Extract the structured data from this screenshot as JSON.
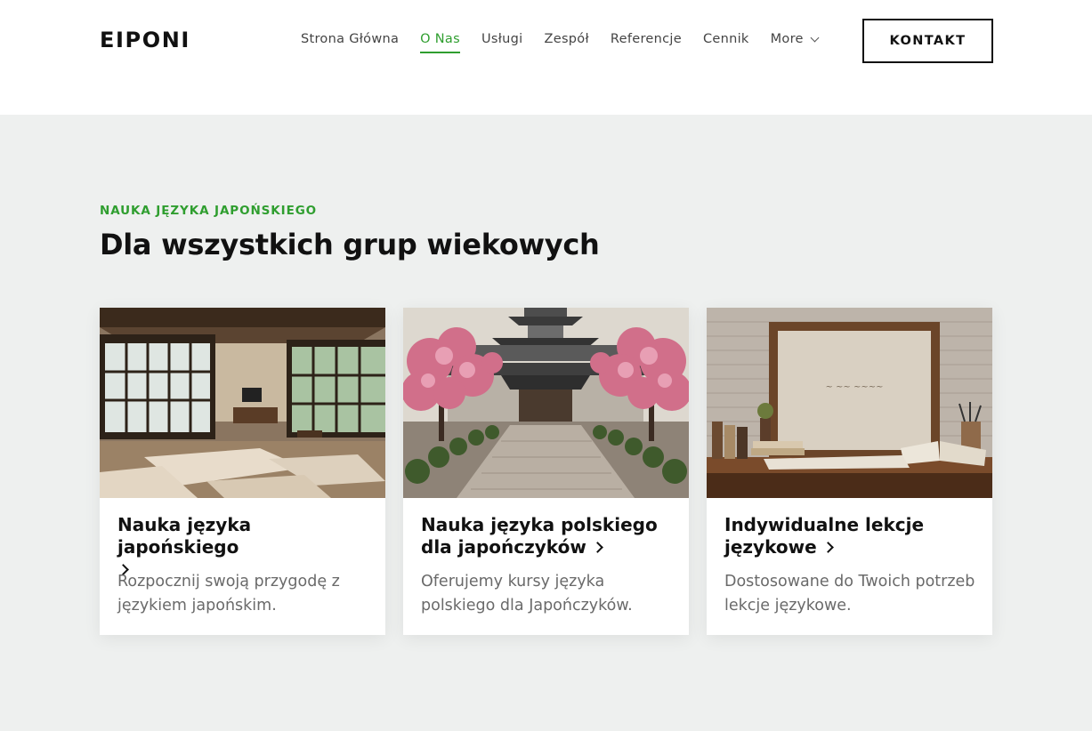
{
  "brand": {
    "logo": "EIPONI",
    "accent_color": "#2f9e2f"
  },
  "nav": {
    "items": [
      {
        "label": "Strona Główna",
        "active": false
      },
      {
        "label": "O Nas",
        "active": true
      },
      {
        "label": "Usługi",
        "active": false
      },
      {
        "label": "Zespół",
        "active": false
      },
      {
        "label": "Referencje",
        "active": false
      },
      {
        "label": "Cennik",
        "active": false
      },
      {
        "label": "More",
        "active": false,
        "icon": "chevron-down-icon"
      }
    ],
    "contact_button": "KONTAKT"
  },
  "section": {
    "eyebrow": "NAUKA JĘZYKA JAPOŃSKIEGO",
    "heading": "Dla wszystkich grup wiekowych"
  },
  "cards": [
    {
      "title": "Nauka języka japońskiego",
      "description": "Rozpocznij swoją przygodę z językiem japońskim.",
      "image": "japanese-tatami-room"
    },
    {
      "title": "Nauka języka polskiego dla japończyków",
      "description": "Oferujemy kursy języka polskiego dla Japończyków.",
      "image": "japanese-temple-with-cherry-blossoms"
    },
    {
      "title": "Indywidualne lekcje językowe",
      "description": "Dostosowane do Twoich potrzeb lekcje językowe.",
      "image": "framed-board-on-desk-with-books"
    }
  ]
}
